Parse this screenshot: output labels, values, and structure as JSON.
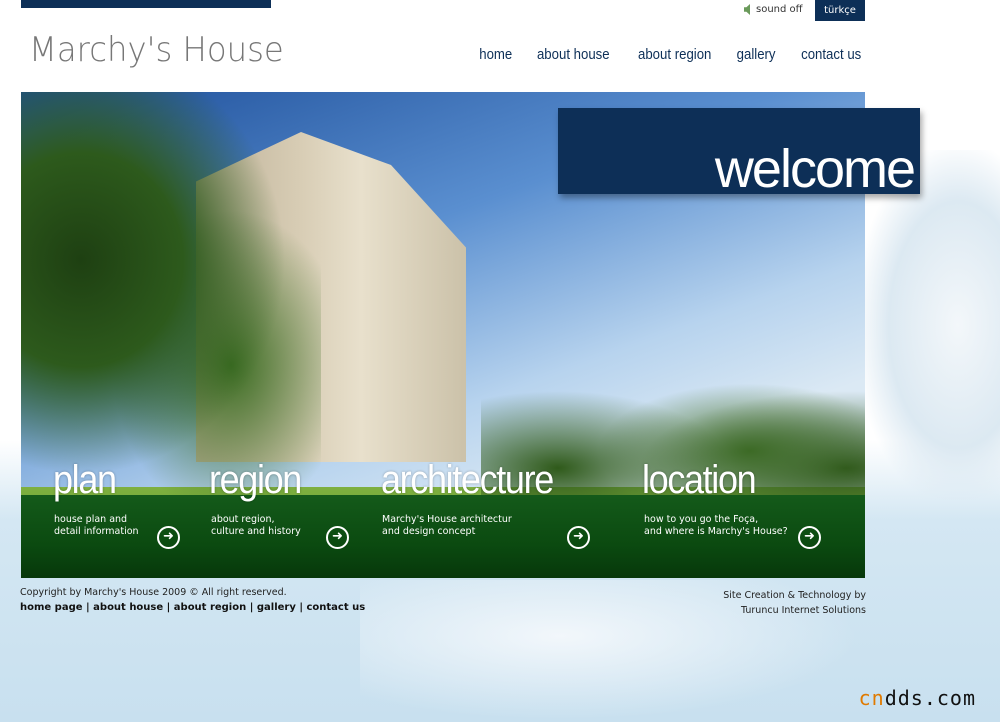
{
  "header": {
    "logo": "Marchy's House",
    "sound_label": "sound off",
    "language_button": "türkçe",
    "nav": [
      "home",
      "about house",
      "about region",
      "gallery",
      "contact us"
    ]
  },
  "hero": {
    "welcome": "welcome",
    "sections": [
      {
        "title": "plan",
        "desc1": "house plan and",
        "desc2": "detail information"
      },
      {
        "title": "region",
        "desc1": "about region,",
        "desc2": "culture and history"
      },
      {
        "title": "architecture",
        "desc1": "Marchy's House architectur",
        "desc2": "and design concept"
      },
      {
        "title": "location",
        "desc1": "how to you go the Foça,",
        "desc2": "and where is Marchy's House?"
      }
    ]
  },
  "footer": {
    "copyright": "Copyright by Marchy's House 2009 © All right reserved.",
    "links": [
      "home page",
      "about house",
      "about region",
      "gallery",
      "contact us"
    ],
    "separator": "|",
    "credit1": "Site Creation & Technology by",
    "credit2": "Turuncu Internet Solutions"
  },
  "watermark": {
    "part1": "cn",
    "part2": "dds.com"
  },
  "colors": {
    "navy": "#0d2f57",
    "green_band": "#0b4a10"
  }
}
